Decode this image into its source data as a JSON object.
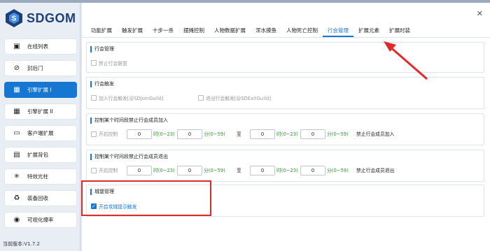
{
  "app": {
    "logo_text": "SDGOM",
    "version": "当前版本:V1.7.2",
    "close_symbol": "✕"
  },
  "sidebar": {
    "items": [
      {
        "label": "在线列表",
        "icon": "user-list-icon",
        "glyph": "▣"
      },
      {
        "label": "封后门",
        "icon": "ban-icon",
        "glyph": "⊘"
      },
      {
        "label": "引擎扩展 I",
        "icon": "grid-icon",
        "glyph": "▦"
      },
      {
        "label": "引擎扩展 II",
        "icon": "grid-icon",
        "glyph": "▦"
      },
      {
        "label": "客户端扩展",
        "icon": "monitor-icon",
        "glyph": "▭"
      },
      {
        "label": "扩展背包",
        "icon": "backpack-icon",
        "glyph": "▤"
      },
      {
        "label": "特效光柱",
        "icon": "sparkle-icon",
        "glyph": "✳"
      },
      {
        "label": "装备回收",
        "icon": "recycle-icon",
        "glyph": "♻"
      },
      {
        "label": "可视化爆率",
        "icon": "eye-icon",
        "glyph": "◉"
      }
    ],
    "active_index": 2
  },
  "tabs": [
    "功能扩展",
    "触发扩展",
    "十步一杀",
    "摆摊控制",
    "人物数据扩展",
    "浑水摸鱼",
    "人物死亡控制",
    "行会管理",
    "扩展元素",
    "扩展时装"
  ],
  "active_tab_index": 7,
  "sections": {
    "guild_mgmt": {
      "title": "行会管理",
      "checkbox": "禁止行会联盟"
    },
    "guild_trigger": {
      "title": "行会触发",
      "join": "加入行会触发[@SDJoinGuild]",
      "exit": "退出行会触发[@SDExitGuild]"
    },
    "join_time": {
      "title": "控制某个时间段禁止行会成员加入",
      "enable": "开启控制",
      "from_hour": "0",
      "from_min": "0",
      "to_hour": "0",
      "to_min": "0",
      "hour_unit": "时(0~23)",
      "min_unit": "分(0~59)",
      "to": "至",
      "suffix": "禁止行会成员加入"
    },
    "exit_time": {
      "title": "控制某个时间段禁止行会成员退出",
      "enable": "开启控制",
      "from_hour": "0",
      "from_min": "0",
      "to_hour": "0",
      "to_min": "0",
      "hour_unit": "时(0~23)",
      "min_unit": "分(0~59)",
      "to": "至",
      "suffix": "禁止行会成员退出"
    },
    "castle": {
      "title": "城堡管理",
      "checkbox": "开启攻城提示触发",
      "checked": true
    }
  },
  "colors": {
    "accent": "#1677d2",
    "annotation": "#e02a2a",
    "unit_green": "#2e9a2e"
  }
}
